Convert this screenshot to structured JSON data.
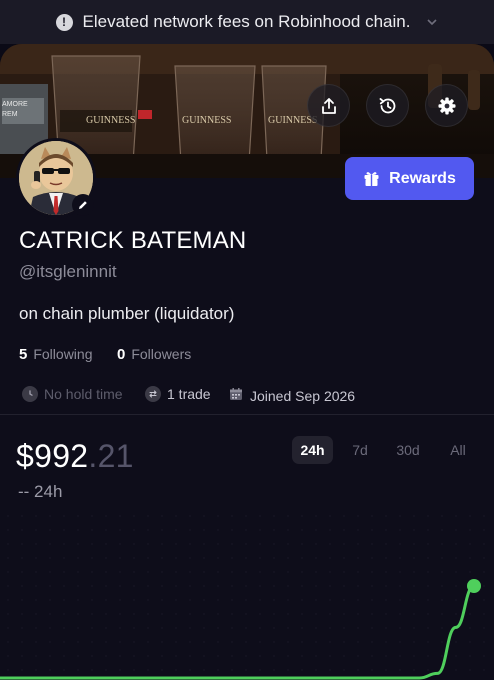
{
  "notice": {
    "text": "Elevated network fees on Robinhood chain."
  },
  "profile": {
    "name": "CATRICK BATEMAN",
    "handle": "@itsgleninnit",
    "bio": "on chain plumber (liquidator)",
    "following_count": "5",
    "following_label": "Following",
    "followers_count": "0",
    "followers_label": "Followers",
    "hold_time": "No hold time",
    "trades": "1 trade",
    "joined": "Joined Sep 2026"
  },
  "cover": {
    "signs": [
      "GUINNESS",
      "GUINNESS",
      "GUINNESS"
    ],
    "left_sign": [
      "AMORE",
      "REM"
    ]
  },
  "actions": {
    "rewards_label": "Rewards"
  },
  "portfolio": {
    "balance_main": "$992",
    "balance_cents": ".21",
    "change": "-- 24h",
    "ranges": [
      "24h",
      "7d",
      "30d",
      "All"
    ],
    "active_range": "24h"
  },
  "colors": {
    "accent": "#5259f0",
    "line": "#4fcf5c",
    "background": "#0e0d1a"
  },
  "chart_data": {
    "type": "line",
    "series": [
      {
        "values": [
          0,
          0,
          0,
          0,
          0,
          0,
          0,
          0,
          0,
          0,
          0,
          0,
          0,
          0,
          0,
          0,
          0,
          0,
          0,
          0,
          0,
          0,
          0,
          0,
          0.05,
          0.55,
          1
        ]
      }
    ]
  }
}
